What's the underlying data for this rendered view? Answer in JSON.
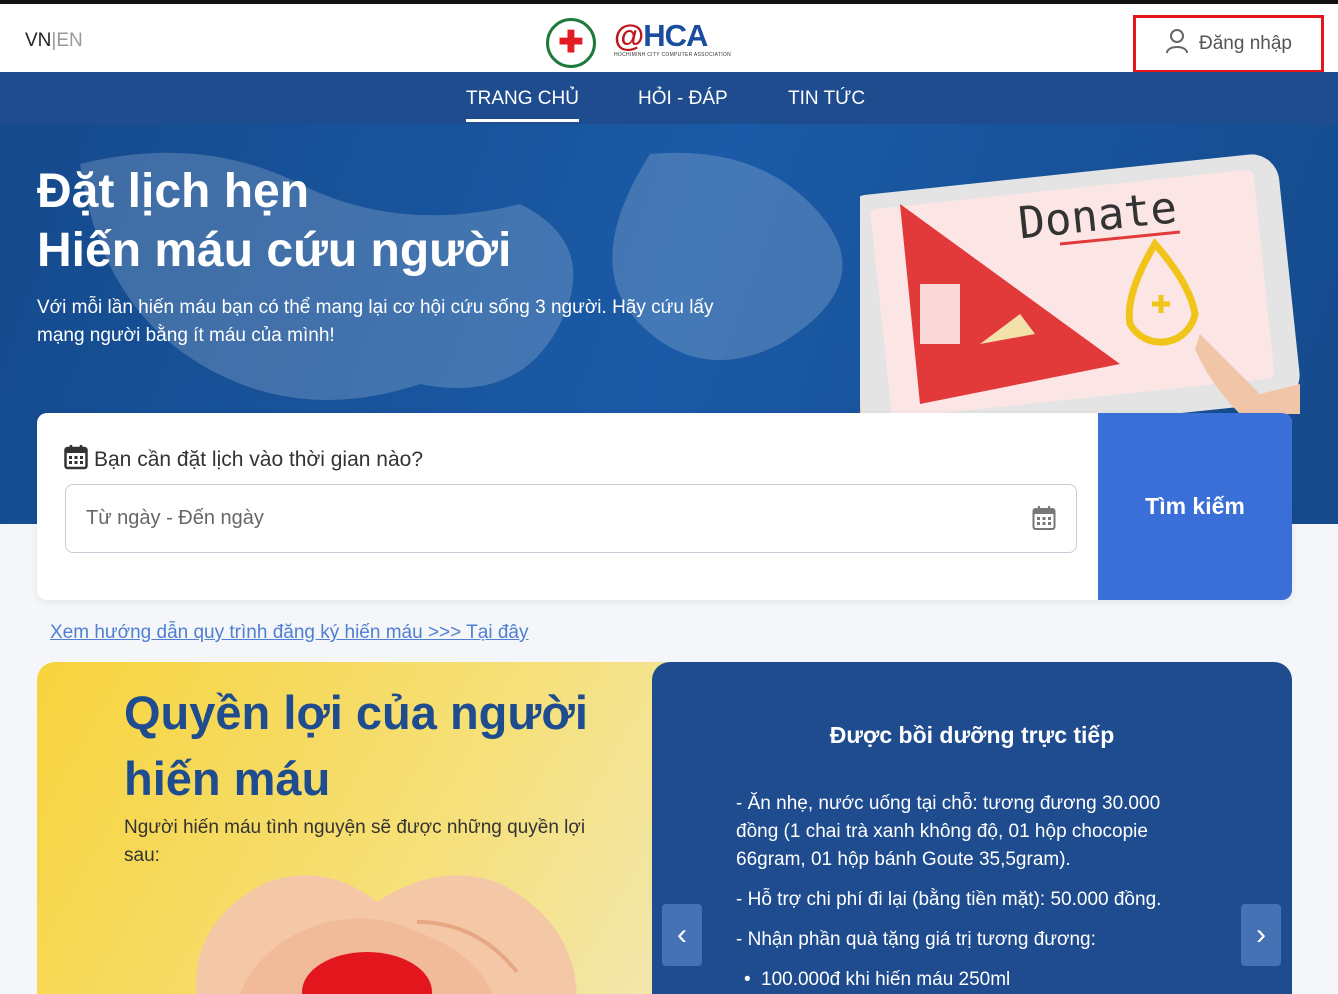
{
  "header": {
    "lang_vn": "VN",
    "lang_sep": "|",
    "lang_en": "EN",
    "logo_hca_at": "@",
    "logo_hca_text": "HCA",
    "logo_hca_sub": "HOCHIMINH CITY COMPUTER ASSOCIATION",
    "login_label": "Đăng nhập"
  },
  "nav": {
    "items": [
      {
        "label": "TRANG CHỦ"
      },
      {
        "label": "HỎI - ĐÁP"
      },
      {
        "label": "TIN TỨC"
      }
    ]
  },
  "hero": {
    "title_line1": "Đặt lịch hẹn",
    "title_line2": "Hiến máu cứu người",
    "text": "Với mỗi lần hiến máu bạn có thể mang lại cơ hội cứu sống 3 người. Hãy cứu lấy mạng người bằng ít máu của mình!",
    "tablet_word": "Donate"
  },
  "search": {
    "label": "Bạn cần đặt lịch vào thời gian nào?",
    "placeholder": "Từ ngày - Đến ngày",
    "button": "Tìm kiếm"
  },
  "guide_link": "Xem hướng dẫn quy trình đăng ký hiến máu >>> Tại đây",
  "benefits": {
    "title": "Quyền lợi của người hiến máu",
    "subtitle": "Người hiến máu tình nguyện sẽ được những quyền lợi sau:",
    "card_title": "Được bồi dưỡng trực tiếp",
    "items": [
      "- Ăn nhẹ, nước uống tại chỗ: tương đương 30.000 đồng (1 chai trà xanh không độ, 01 hộp chocopie 66gram, 01 hộp bánh Goute 35,5gram).",
      "- Hỗ trợ chi phí đi lại (bằng tiền mặt): 50.000 đồng.",
      "- Nhận phần quà tặng giá trị tương đương:"
    ],
    "bullets": [
      "100.000đ khi hiến máu 250ml"
    ],
    "prev_arrow": "‹",
    "next_arrow": "›"
  },
  "colors": {
    "nav_blue": "#1e4c8f",
    "button_blue": "#3a6fd8",
    "login_border": "#e3151d",
    "yellow": "#f7d33c"
  }
}
